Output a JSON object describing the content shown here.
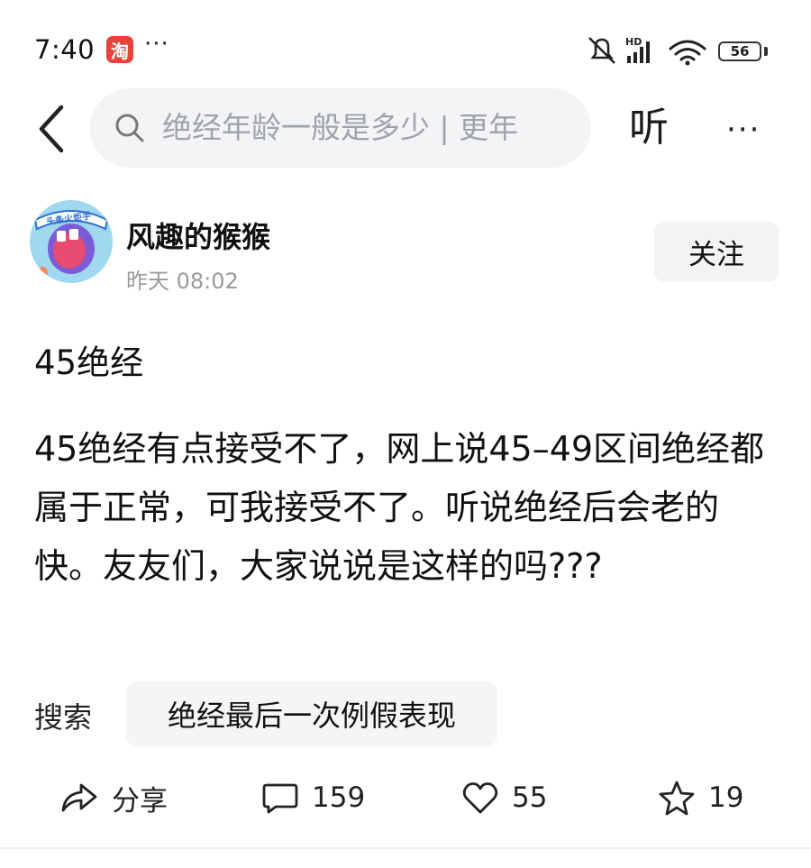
{
  "status_bar": {
    "time": "7:40",
    "app_badge": "淘",
    "more_dots": "···",
    "network": "HD",
    "battery": "56"
  },
  "header": {
    "search_text": "绝经年龄一般是多少 | 更年",
    "listen_label": "听",
    "more_label": "···"
  },
  "author": {
    "avatar_text": "头条火炬手",
    "name": "风趣的猴猴",
    "time": "昨天  08:02",
    "follow_label": "关注"
  },
  "post": {
    "title": "45绝经",
    "body": "45绝经有点接受不了，网上说45–49区间绝经都属于正常，可我接受不了。听说绝经后会老的快。友友们，大家说说是这样的吗???"
  },
  "search_suggestion": {
    "label": "搜索",
    "query": "绝经最后一次例假表现"
  },
  "actions": {
    "share_label": "分享",
    "comments": "159",
    "likes": "55",
    "favorites": "19"
  },
  "colors": {
    "search_bg": "#f3f4f6",
    "follow_bg": "#f2f3f5",
    "text": "#111111",
    "muted": "#9a9a9a",
    "taobao": "#e8433b"
  }
}
